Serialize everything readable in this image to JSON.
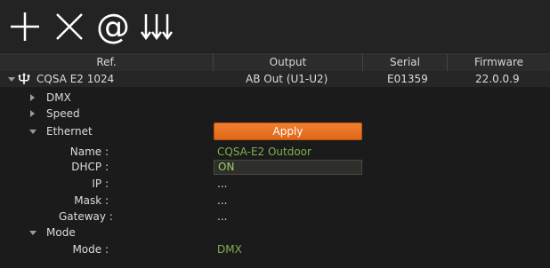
{
  "toolbar": {
    "icons": [
      "plus-icon",
      "close-icon",
      "at-icon",
      "arrows-down-icon"
    ]
  },
  "columns": [
    "Ref.",
    "Output",
    "Serial",
    "Firmware"
  ],
  "device": {
    "ref": "CQSA E2 1024",
    "output": "AB Out (U1-U2)",
    "serial": "E01359",
    "firmware": "22.0.0.9"
  },
  "groups": {
    "dmx": "DMX",
    "speed": "Speed",
    "ethernet": "Ethernet",
    "mode": "Mode"
  },
  "ethernet": {
    "apply_label": "Apply",
    "name_label": "Name :",
    "name_value": "CQSA-E2 Outdoor",
    "dhcp_label": "DHCP :",
    "dhcp_value": "ON",
    "ip_label": "IP :",
    "ip_value": "...",
    "mask_label": "Mask :",
    "mask_value": "...",
    "gateway_label": "Gateway :",
    "gateway_value": "..."
  },
  "mode": {
    "mode_label": "Mode :",
    "mode_value": "DMX"
  },
  "colors": {
    "accent": "#e8741e",
    "value_green": "#7fb050",
    "background": "#1b1b1b"
  }
}
